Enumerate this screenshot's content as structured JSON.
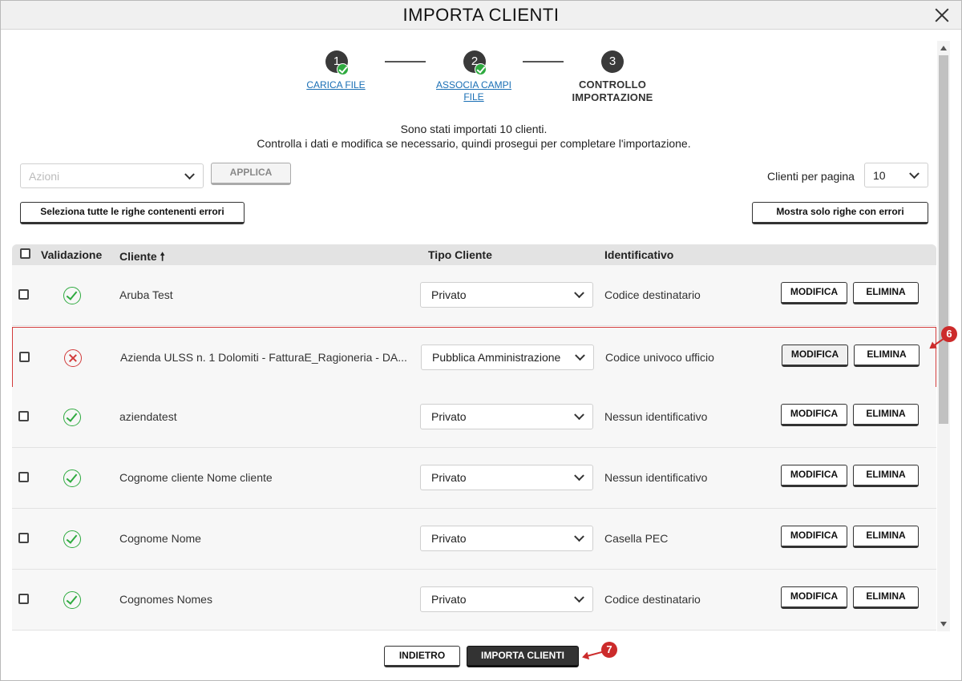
{
  "window": {
    "title": "IMPORTA CLIENTI"
  },
  "stepper": {
    "steps": [
      {
        "number": "1",
        "label": "CARICA FILE"
      },
      {
        "number": "2",
        "label_line1": "ASSOCIA CAMPI",
        "label_line2": "FILE"
      },
      {
        "number": "3",
        "label_line1": "CONTROLLO",
        "label_line2": "IMPORTAZIONE"
      }
    ]
  },
  "info": {
    "line1": "Sono stati importati 10 clienti.",
    "line2": "Controlla i dati e modifica se necessario, quindi prosegui per completare l'importazione."
  },
  "toolbar": {
    "actions_placeholder": "Azioni",
    "apply_label": "APPLICA",
    "per_page_label": "Clienti per pagina",
    "per_page_value": "10",
    "select_errors_label": "Seleziona tutte le righe contenenti errori",
    "show_errors_label": "Mostra solo righe con errori"
  },
  "table": {
    "headers": {
      "validation": "Validazione",
      "client": "Cliente",
      "client_sort": "🠕",
      "type": "Tipo Cliente",
      "identifier": "Identificativo"
    },
    "edit_label": "MODIFICA",
    "delete_label": "ELIMINA",
    "rows": [
      {
        "client": "Aruba Test",
        "type": "Privato",
        "identifier": "Codice destinatario",
        "valid": true
      },
      {
        "client": "Azienda ULSS n. 1 Dolomiti - FatturaE_Ragioneria - DA...",
        "type": "Pubblica Amministrazione",
        "identifier": "Codice univoco ufficio",
        "valid": false
      },
      {
        "client": "aziendatest",
        "type": "Privato",
        "identifier": "Nessun identificativo",
        "valid": true
      },
      {
        "client": "Cognome cliente Nome cliente",
        "type": "Privato",
        "identifier": "Nessun identificativo",
        "valid": true
      },
      {
        "client": "Cognome Nome",
        "type": "Privato",
        "identifier": "Casella PEC",
        "valid": true
      },
      {
        "client": "Cognomes Nomes",
        "type": "Privato",
        "identifier": "Codice destinatario",
        "valid": true
      }
    ]
  },
  "footer": {
    "back_label": "INDIETRO",
    "import_label": "IMPORTA CLIENTI"
  },
  "annotations": {
    "badge_6": "6",
    "badge_7": "7"
  },
  "colors": {
    "ok": "#2eaa3f",
    "error": "#d23b3b",
    "link": "#1a6fb5",
    "annotation": "#cc2b2b"
  }
}
